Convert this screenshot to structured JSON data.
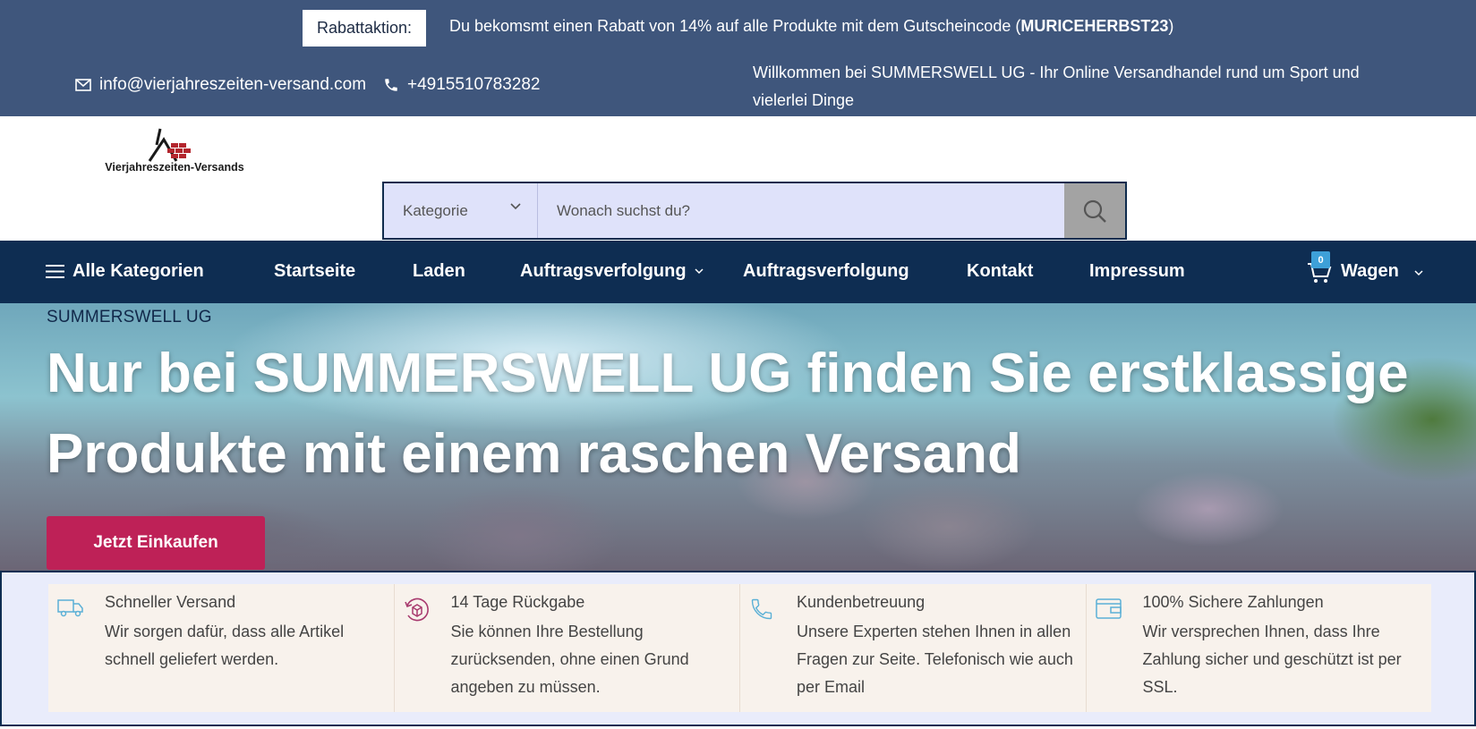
{
  "topbar": {
    "promo_label": "Rabattaktion:",
    "promo_text": "Du bekomsmt einen Rabatt von 14% auf alle Produkte mit dem Gutscheincode (",
    "promo_code": "MURICEHERBST23",
    "promo_close": ")",
    "email": "info@vierjahreszeiten-versand.com",
    "phone": "+4915510783282",
    "welcome": "Willkommen bei SUMMERSWELL UG - Ihr Online Versandhandel rund um Sport und vielerlei Dinge"
  },
  "header": {
    "logo_text": "Vierjahreszeiten-Versands",
    "search": {
      "category": "Kategorie",
      "placeholder": "Wonach suchst du?"
    }
  },
  "nav": {
    "all_categories": "Alle Kategorien",
    "items": [
      {
        "label": "Startseite"
      },
      {
        "label": "Laden"
      },
      {
        "label": "Auftragsverfolgung"
      },
      {
        "label": "Auftragsverfolgung"
      },
      {
        "label": "Kontakt"
      },
      {
        "label": "Impressum"
      }
    ],
    "cart_label": "Wagen",
    "cart_count": "0"
  },
  "hero": {
    "subtitle": "SUMMERSWELL UG",
    "title": "Nur bei SUMMERSWELL UG finden Sie erstklassige Produkte mit einem raschen Versand",
    "cta": "Jetzt Einkaufen"
  },
  "features": [
    {
      "icon": "truck-icon",
      "title": "Schneller Versand",
      "desc": "Wir sorgen dafür, dass alle Artikel schnell geliefert werden."
    },
    {
      "icon": "return-box-icon",
      "title": "14 Tage Rückgabe",
      "desc": "Sie können Ihre Bestellung zurücksenden, ohne einen Grund angeben zu müssen."
    },
    {
      "icon": "phone-icon",
      "title": "Kundenbetreuung",
      "desc": "Unsere Experten stehen Ihnen in allen Fragen zur Seite. Telefonisch wie auch per Email"
    },
    {
      "icon": "wallet-icon",
      "title": "100% Sichere Zahlungen",
      "desc": "Wir versprechen Ihnen, dass Ihre Zahlung sicher und geschützt ist per SSL."
    }
  ],
  "colors": {
    "topbar": "#3f567c",
    "nav": "#0e2d52",
    "cta": "#be2157",
    "badge": "#3ea0d8"
  }
}
